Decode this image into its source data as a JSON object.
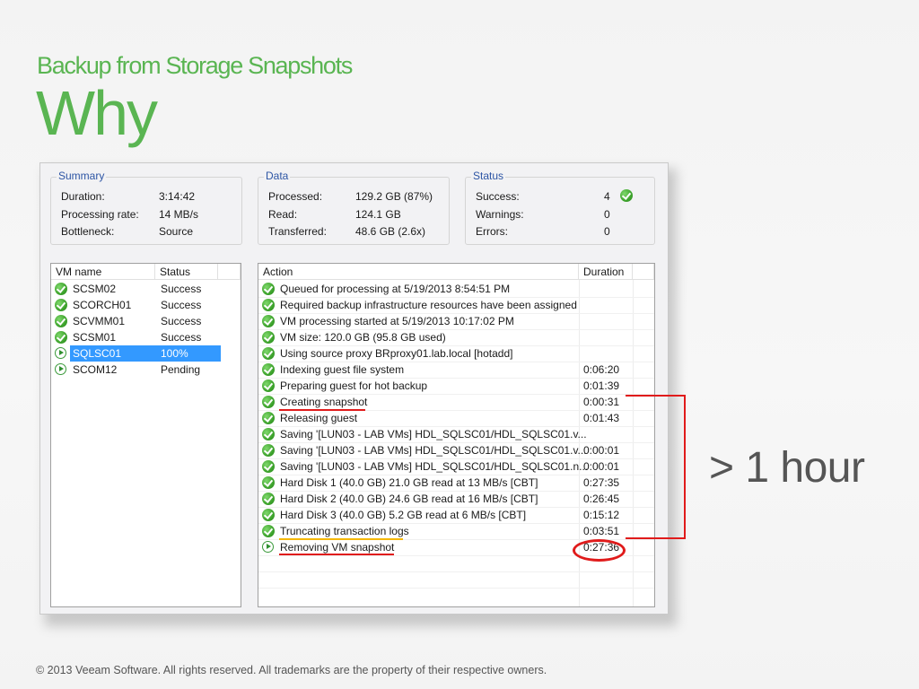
{
  "slide": {
    "subtitle": "Backup from Storage Snapshots",
    "title": "Why",
    "callout": "> 1 hour",
    "footer": "© 2013 Veeam Software. All rights reserved. All trademarks are the property of their respective owners."
  },
  "colors": {
    "brand_green": "#5ab552",
    "highlight_red": "#e01b1b",
    "highlight_yellow": "#f5b700",
    "selection_blue": "#3399ff"
  },
  "summary": {
    "legend": "Summary",
    "items": [
      {
        "label": "Duration:",
        "value": "3:14:42"
      },
      {
        "label": "Processing rate:",
        "value": "14 MB/s"
      },
      {
        "label": "Bottleneck:",
        "value": "Source"
      }
    ]
  },
  "data_group": {
    "legend": "Data",
    "items": [
      {
        "label": "Processed:",
        "value": "129.2 GB (87%)"
      },
      {
        "label": "Read:",
        "value": "124.1 GB"
      },
      {
        "label": "Transferred:",
        "value": "48.6 GB (2.6x)"
      }
    ]
  },
  "status_group": {
    "legend": "Status",
    "items": [
      {
        "label": "Success:",
        "value": "4"
      },
      {
        "label": "Warnings:",
        "value": "0"
      },
      {
        "label": "Errors:",
        "value": "0"
      }
    ]
  },
  "vm_list": {
    "headers": [
      "VM name",
      "Status"
    ],
    "rows": [
      {
        "name": "SCSM02",
        "status": "Success",
        "icon": "success-icon"
      },
      {
        "name": "SCORCH01",
        "status": "Success",
        "icon": "success-icon"
      },
      {
        "name": "SCVMM01",
        "status": "Success",
        "icon": "success-icon"
      },
      {
        "name": "SCSM01",
        "status": "Success",
        "icon": "success-icon"
      },
      {
        "name": "SQLSC01",
        "status": "100%",
        "icon": "running-icon",
        "selected": true
      },
      {
        "name": "SCOM12",
        "status": "Pending",
        "icon": "running-icon"
      }
    ]
  },
  "action_log": {
    "headers": [
      "Action",
      "Duration"
    ],
    "rows": [
      {
        "action": "Queued for processing at 5/19/2013 8:54:51 PM",
        "duration": "",
        "icon": "success-icon"
      },
      {
        "action": "Required backup infrastructure resources have been assigned",
        "duration": "",
        "icon": "success-icon"
      },
      {
        "action": "VM processing started at 5/19/2013 10:17:02 PM",
        "duration": "",
        "icon": "success-icon"
      },
      {
        "action": "VM size: 120.0 GB (95.8 GB used)",
        "duration": "",
        "icon": "success-icon"
      },
      {
        "action": "Using source proxy BRproxy01.lab.local [hotadd]",
        "duration": "",
        "icon": "success-icon"
      },
      {
        "action": "Indexing guest file system",
        "duration": "0:06:20",
        "icon": "success-icon"
      },
      {
        "action": "Preparing guest for hot backup",
        "duration": "0:01:39",
        "icon": "success-icon"
      },
      {
        "action": "Creating snapshot",
        "duration": "0:00:31",
        "icon": "success-icon",
        "highlight": "red"
      },
      {
        "action": "Releasing guest",
        "duration": "0:01:43",
        "icon": "success-icon"
      },
      {
        "action": "Saving '[LUN03 - LAB VMs] HDL_SQLSC01/HDL_SQLSC01.v...",
        "duration": "",
        "icon": "success-icon"
      },
      {
        "action": "Saving '[LUN03 - LAB VMs] HDL_SQLSC01/HDL_SQLSC01.v...",
        "duration": "0:00:01",
        "icon": "success-icon"
      },
      {
        "action": "Saving '[LUN03 - LAB VMs] HDL_SQLSC01/HDL_SQLSC01.n...",
        "duration": "0:00:01",
        "icon": "success-icon"
      },
      {
        "action": "Hard Disk 1 (40.0 GB) 21.0 GB read at 13 MB/s [CBT]",
        "duration": "0:27:35",
        "icon": "success-icon"
      },
      {
        "action": "Hard Disk 2 (40.0 GB) 24.6 GB read at 16 MB/s [CBT]",
        "duration": "0:26:45",
        "icon": "success-icon"
      },
      {
        "action": "Hard Disk 3 (40.0 GB) 5.2 GB read at 6 MB/s [CBT]",
        "duration": "0:15:12",
        "icon": "success-icon"
      },
      {
        "action": "Truncating transaction logs",
        "duration": "0:03:51",
        "icon": "success-icon",
        "highlight": "yellow"
      },
      {
        "action": "Removing VM snapshot",
        "duration": "0:27:36",
        "icon": "running-icon",
        "highlight": "red"
      }
    ]
  }
}
